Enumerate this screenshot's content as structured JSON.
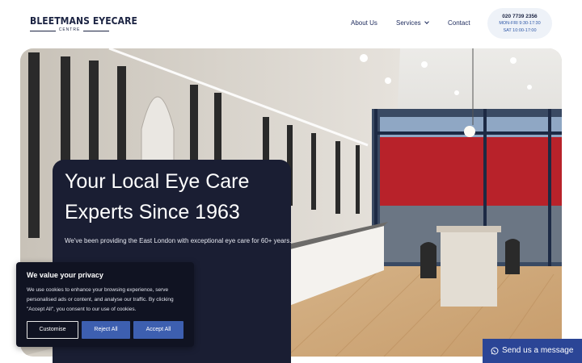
{
  "header": {
    "logo_main": "BLEETMANS EYECARE",
    "logo_sub": "CENTRE",
    "nav": {
      "about": "About Us",
      "services": "Services",
      "contact": "Contact"
    },
    "contact_box": {
      "phone": "020 7739 2356",
      "hours_weekday": "MON-FRI 9:30-17:30",
      "hours_saturday": "SAT 10:00-17:00"
    }
  },
  "hero": {
    "title_line1": "Your Local Eye Care",
    "title_line2": "Experts Since 1963",
    "subtitle": "We've been providing the East London with exceptional eye care for 60+ years."
  },
  "cookie_banner": {
    "title": "We value your privacy",
    "text": "We use cookies to enhance your browsing experience, serve personalised ads or content, and analyse our traffic. By clicking \"Accept All\", you consent to our use of cookies.",
    "customise_label": "Customise",
    "reject_label": "Reject All",
    "accept_label": "Accept All"
  },
  "chat": {
    "label": "Send us a message",
    "icon": "whatsapp-icon"
  },
  "colors": {
    "brand_navy": "#1c2443",
    "accent_blue": "#3d5fb0",
    "chat_blue": "#2b4596",
    "hero_card": "#1a1e33"
  }
}
